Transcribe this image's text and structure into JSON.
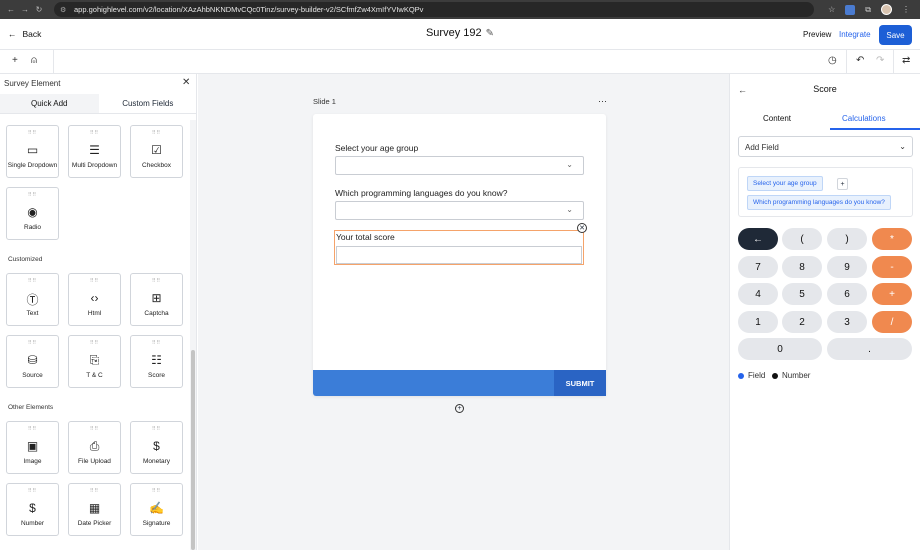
{
  "browser": {
    "url": "app.gohighlevel.com/v2/location/XAzAhbNKNDMvCQc0Tinz/survey-builder-v2/SCfmfZw4XmIfYVIwKQPv"
  },
  "header": {
    "back_label": "Back",
    "title": "Survey 192",
    "preview_label": "Preview",
    "integrate_label": "Integrate",
    "save_label": "Save"
  },
  "left_panel": {
    "title": "Survey Element",
    "tabs": [
      "Quick Add",
      "Custom Fields"
    ],
    "basic_items": [
      "Single Dropdown",
      "Multi Dropdown",
      "Checkbox",
      "Radio"
    ],
    "customized_label": "Customized",
    "customized_items": [
      "Text",
      "Html",
      "Captcha",
      "Source",
      "T & C",
      "Score"
    ],
    "other_label": "Other Elements",
    "other_items": [
      "Image",
      "File Upload",
      "Monetary",
      "Number",
      "Date Picker",
      "Signature"
    ]
  },
  "canvas": {
    "slide_label": "Slide 1",
    "questions": [
      "Select your age group",
      "Which programming languages do you know?"
    ],
    "score_label": "Your total score",
    "submit_label": "SUBMIT"
  },
  "right_panel": {
    "title": "Score",
    "tabs": [
      "Content",
      "Calculations"
    ],
    "add_field_label": "Add Field",
    "formula_chip_1": "Select your age group",
    "formula_op": "+",
    "formula_chip_2": "Which programming languages do you know?",
    "keypad": [
      "←",
      "(",
      ")",
      "*",
      "7",
      "8",
      "9",
      "-",
      "4",
      "5",
      "6",
      "+",
      "1",
      "2",
      "3",
      "/",
      "0",
      "."
    ],
    "legend_field": "Field",
    "legend_number": "Number",
    "colors": {
      "field_dot": "#2563eb",
      "number_dot": "#111111",
      "operator": "#f0894f"
    }
  }
}
